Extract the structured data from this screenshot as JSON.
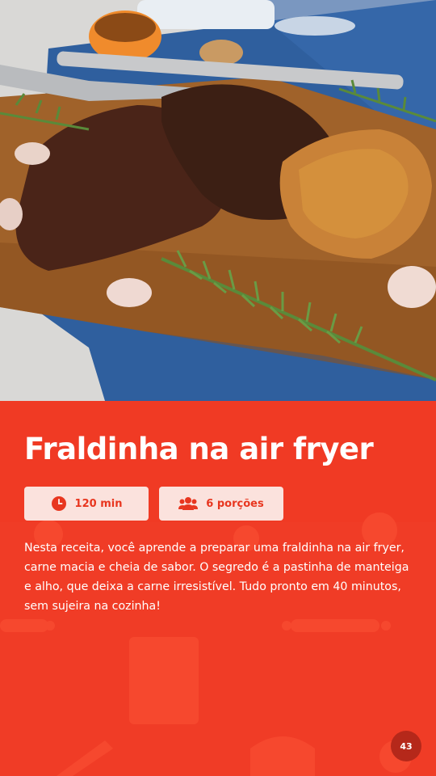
{
  "recipe": {
    "title": "Fraldinha na air fryer",
    "time": "120 min",
    "servings": "6 porções",
    "description": "Nesta receita, você aprende a preparar uma fraldinha na air fryer, carne macia e cheia de sabor. O segredo é a pastinha de manteiga e alho, que deixa a carne irresistível. Tudo pronto em 40 minutos, sem sujeira na cozinha!"
  },
  "page": {
    "number": "43"
  },
  "icons": {
    "time": "clock-icon",
    "servings": "people-icon"
  },
  "colors": {
    "accent": "#f03a24",
    "chip_bg": "#fbe2dd",
    "badge": "#b5281a"
  }
}
